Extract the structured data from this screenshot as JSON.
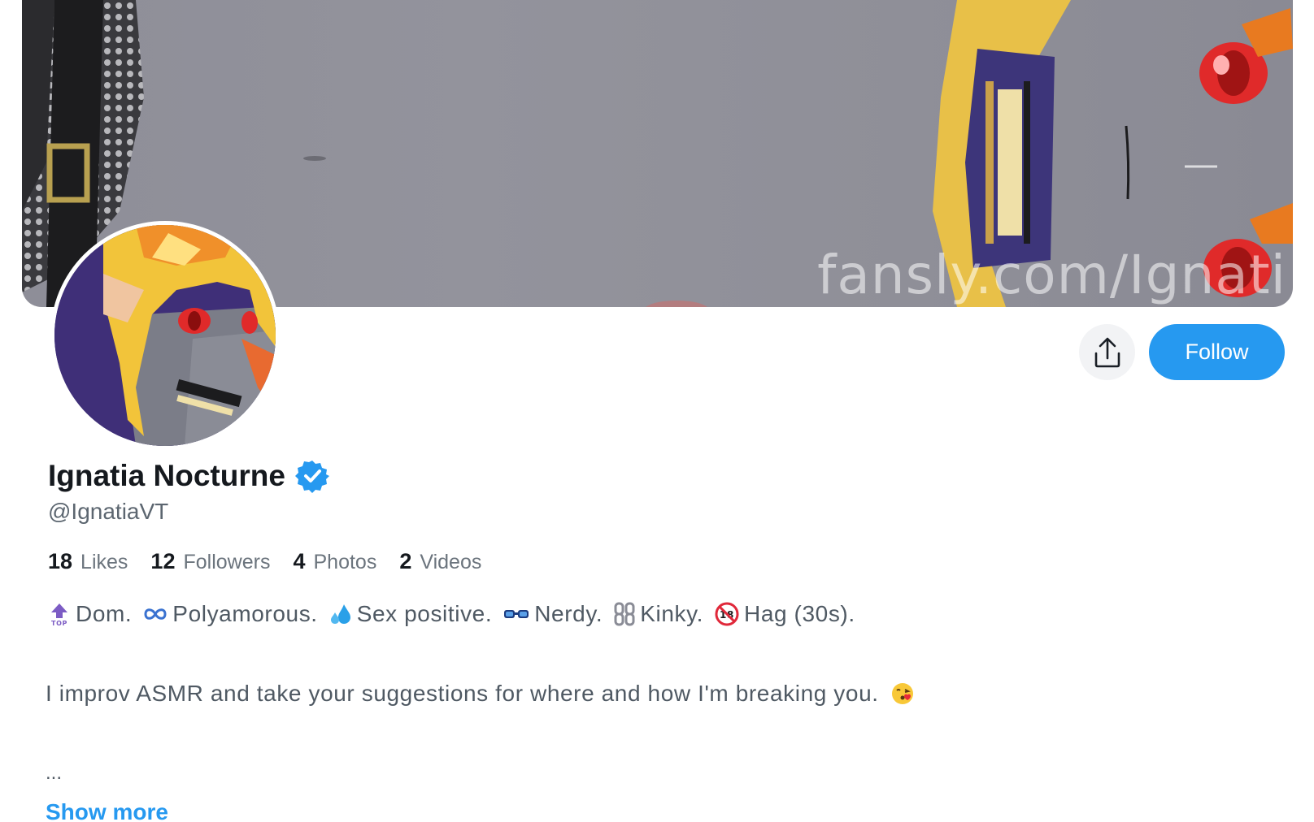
{
  "banner": {
    "watermark": "fansly.com/Ignati"
  },
  "profile": {
    "display_name": "Ignatia Nocturne",
    "verified": true,
    "handle": "@IgnatiaVT",
    "stats": [
      {
        "value": "18",
        "label": "Likes"
      },
      {
        "value": "12",
        "label": "Followers"
      },
      {
        "value": "4",
        "label": "Photos"
      },
      {
        "value": "2",
        "label": "Videos"
      }
    ],
    "bio_tags": [
      {
        "icon": "top-arrow-icon",
        "text": "Dom."
      },
      {
        "icon": "infinity-icon",
        "text": "Polyamorous."
      },
      {
        "icon": "sweat-droplets-icon",
        "text": "Sex positive."
      },
      {
        "icon": "glasses-icon",
        "text": "Nerdy."
      },
      {
        "icon": "chains-icon",
        "text": "Kinky."
      },
      {
        "icon": "no-under-18-icon",
        "text": "Hag (30s)."
      }
    ],
    "bio_line": "I improv ASMR and take your suggestions for where and how I'm breaking you.",
    "bio_line_emoji": "face-blowing-kiss-icon",
    "ellipsis": "...",
    "show_more": "Show more"
  },
  "actions": {
    "share_icon": "share-upload-icon",
    "follow_label": "Follow"
  },
  "colors": {
    "accent": "#2699f0",
    "verified": "#2699f0",
    "muted_text": "#5c6670",
    "banner_gray": "#8e8e98"
  }
}
